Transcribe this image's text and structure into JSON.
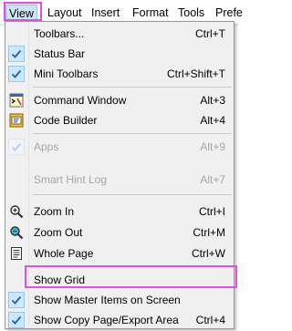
{
  "menubar": {
    "items": [
      {
        "label": "View"
      },
      {
        "label": "Layout"
      },
      {
        "label": "Insert"
      },
      {
        "label": "Format"
      },
      {
        "label": "Tools"
      },
      {
        "label": "Prefe"
      }
    ]
  },
  "menu": {
    "items": [
      {
        "label": "Toolbars...",
        "shortcut": "Ctrl+T",
        "checked": false
      },
      {
        "label": "Status Bar",
        "shortcut": "",
        "checked": true
      },
      {
        "label": "Mini Toolbars",
        "shortcut": "Ctrl+Shift+T",
        "checked": true
      },
      {
        "label": "Command Window",
        "shortcut": "Alt+3",
        "icon": "command-window-icon"
      },
      {
        "label": "Code Builder",
        "shortcut": "Alt+4",
        "icon": "code-builder-icon"
      },
      {
        "label": "Apps",
        "shortcut": "Alt+9",
        "checked": true,
        "disabled": true
      },
      {
        "label": "Smart Hint Log",
        "shortcut": "Alt+7",
        "disabled": true
      },
      {
        "label": "Zoom In",
        "shortcut": "Ctrl+I",
        "icon": "zoom-in-icon"
      },
      {
        "label": "Zoom Out",
        "shortcut": "Ctrl+M",
        "icon": "zoom-out-icon"
      },
      {
        "label": "Whole Page",
        "shortcut": "Ctrl+W",
        "icon": "whole-page-icon"
      },
      {
        "label": "Show Grid",
        "shortcut": ""
      },
      {
        "label": "Show Master Items on Screen",
        "shortcut": "",
        "checked": true
      },
      {
        "label": "Show Copy Page/Export Area",
        "shortcut": "Ctrl+4",
        "checked": true
      }
    ]
  },
  "colors": {
    "highlight": "#e04fe0",
    "check_bg": "#cce8ff",
    "check_mark": "#1f5fb0"
  }
}
